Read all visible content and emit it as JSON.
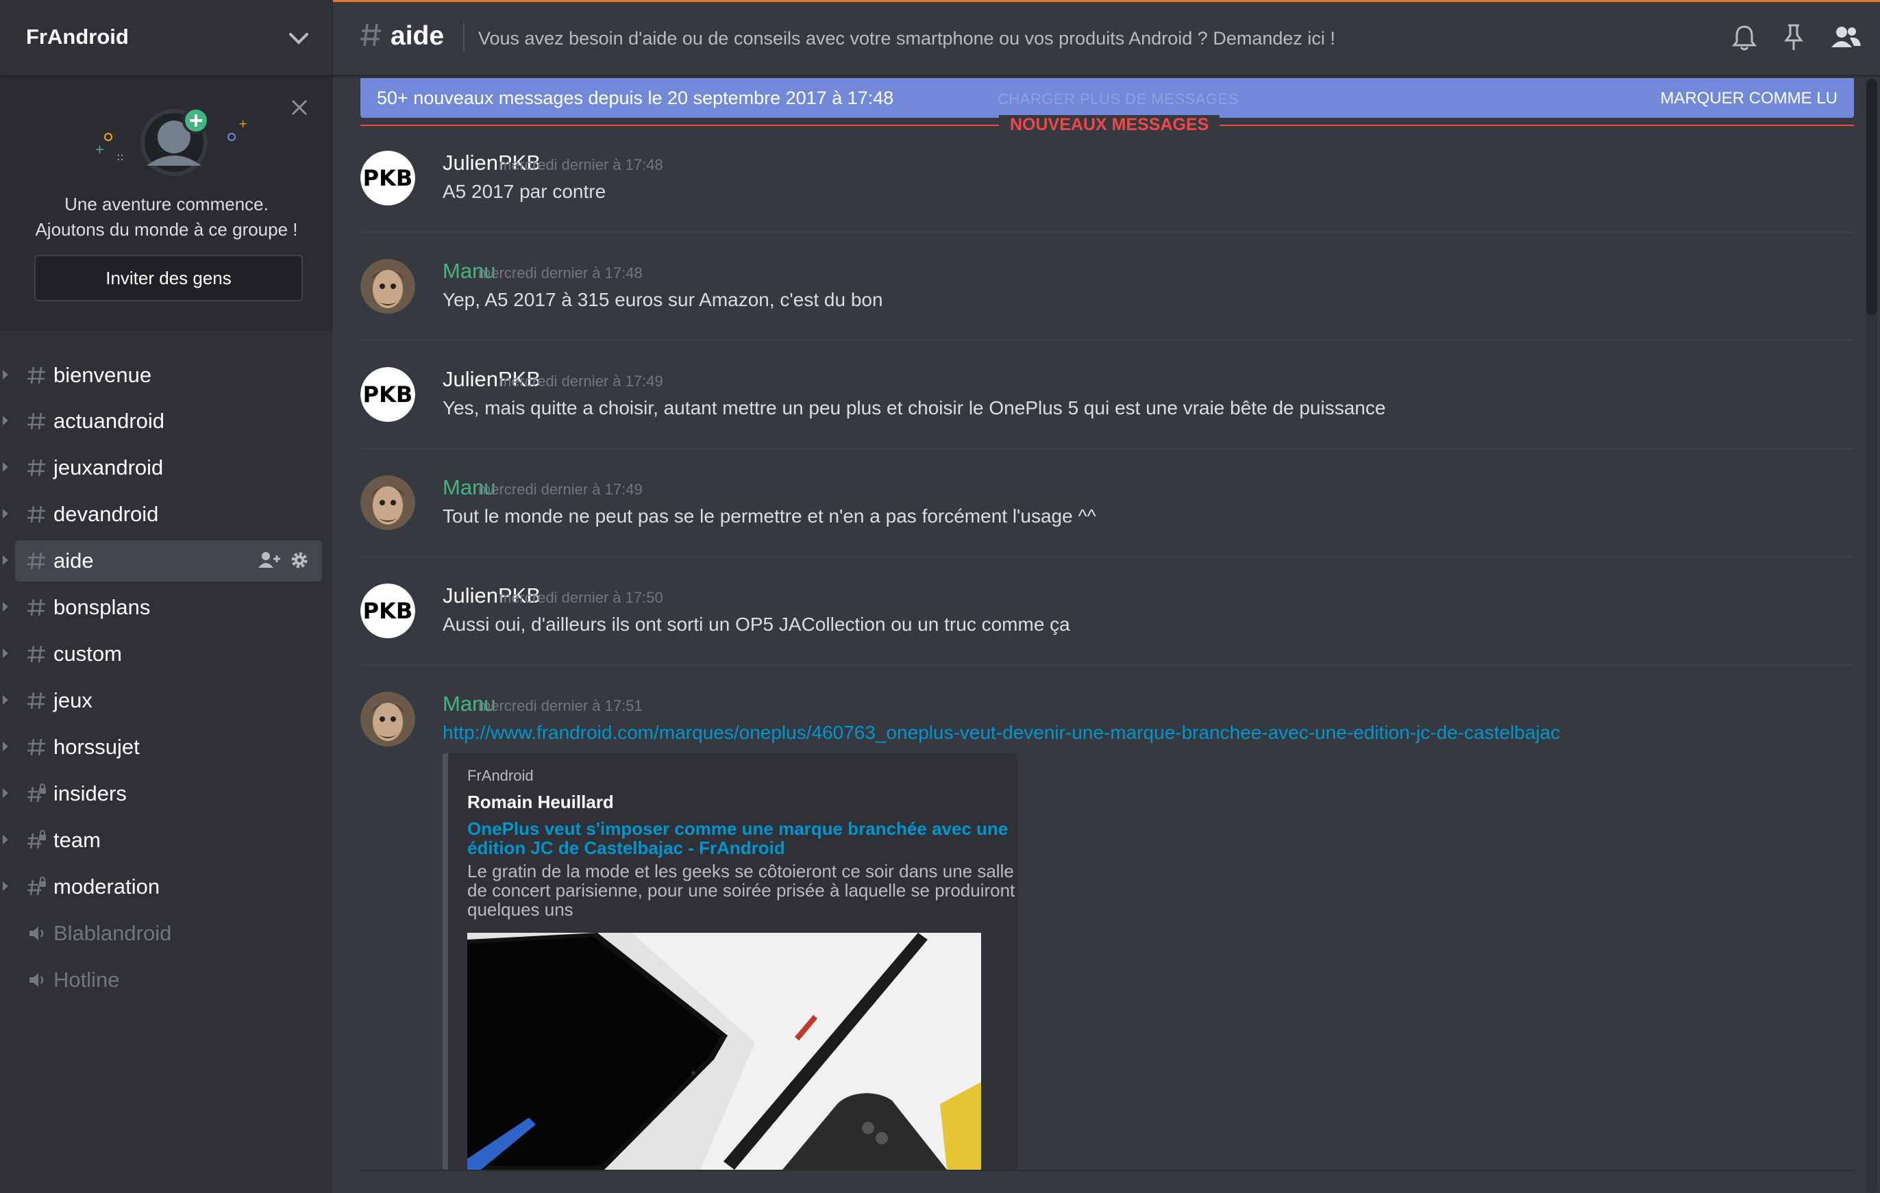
{
  "colors": {
    "accent": "#7289da",
    "mention": "#43b581",
    "new_messages": "#f04747",
    "link": "#0096cf",
    "top_strip": "#e8762e"
  },
  "guild": {
    "name": "FrAndroid",
    "chevron_icon": "chevron-down-icon"
  },
  "invite": {
    "line1": "Une aventure commence.",
    "line2": "Ajoutons du monde à ce groupe !",
    "button": "Inviter des gens"
  },
  "channels": [
    {
      "name": "bienvenue",
      "type": "text"
    },
    {
      "name": "actuandroid",
      "type": "text"
    },
    {
      "name": "jeuxandroid",
      "type": "text"
    },
    {
      "name": "devandroid",
      "type": "text"
    },
    {
      "name": "aide",
      "type": "text",
      "active": true
    },
    {
      "name": "bonsplans",
      "type": "text"
    },
    {
      "name": "custom",
      "type": "text"
    },
    {
      "name": "jeux",
      "type": "text"
    },
    {
      "name": "horssujet",
      "type": "text"
    },
    {
      "name": "insiders",
      "type": "locked"
    },
    {
      "name": "team",
      "type": "locked"
    },
    {
      "name": "moderation",
      "type": "locked"
    },
    {
      "name": "Blablandroid",
      "type": "voice"
    },
    {
      "name": "Hotline",
      "type": "voice"
    }
  ],
  "header": {
    "channel": "aide",
    "topic": "Vous avez besoin d'aide ou de conseils avec votre smartphone ou vos produits Android ? Demandez ici !",
    "icons": [
      "bell-icon",
      "pin-icon",
      "members-icon"
    ]
  },
  "banner": {
    "text": "50+ nouveaux messages depuis le 20 septembre 2017 à 17:48",
    "load_more": "CHARGER PLUS DE MESSAGES",
    "mark_read": "MARQUER COMME LU"
  },
  "new_messages_label": "NOUVEAUX MESSAGES",
  "messages": [
    {
      "author": "JulienPKB",
      "timestamp": "mercredi dernier à 17:48",
      "text": "A5 2017 par contre"
    },
    {
      "author": "Manu",
      "timestamp": "mercredi dernier à 17:48",
      "text": "Yep, A5 2017 à 315 euros sur Amazon, c'est du bon"
    },
    {
      "author": "JulienPKB",
      "timestamp": "mercredi dernier à 17:49",
      "text": "Yes, mais quitte a choisir, autant mettre un peu plus et choisir le OnePlus 5 qui est une vraie bête de puissance"
    },
    {
      "author": "Manu",
      "timestamp": "mercredi dernier à 17:49",
      "text": "Tout le monde ne peut pas se le permettre et n'en a pas forcément l'usage ^^"
    },
    {
      "author": "JulienPKB",
      "timestamp": "mercredi dernier à 17:50",
      "text": "Aussi oui, d'ailleurs ils ont sorti un OP5 JACollection ou un truc comme ça"
    },
    {
      "author": "Manu",
      "timestamp": "mercredi dernier à 17:51",
      "text": "http://www.frandroid.com/marques/oneplus/460763_oneplus-veut-devenir-une-marque-branchee-avec-une-edition-jc-de-castelbajac"
    }
  ],
  "embed": {
    "provider": "FrAndroid",
    "author": "Romain Heuillard",
    "title": "OnePlus veut s'imposer comme une marque branchée avec une édition JC de Castelbajac - FrAndroid",
    "description": "Le gratin de la mode et les geeks se côtoieront ce soir dans une salle de concert parisienne, pour une soirée prisée à laquelle se produiront quelques uns"
  }
}
